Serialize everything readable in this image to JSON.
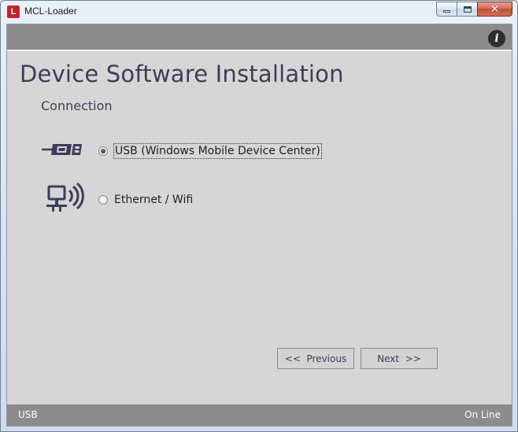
{
  "window": {
    "title": "MCL-Loader",
    "app_icon_letter": "L"
  },
  "header": {
    "title": "Device Software Installation",
    "subtitle": "Connection"
  },
  "options": [
    {
      "label": "USB  (Windows Mobile Device Center)",
      "icon": "usb-icon",
      "selected": true
    },
    {
      "label": "Ethernet / Wifi",
      "icon": "network-wifi-icon",
      "selected": false
    }
  ],
  "buttons": {
    "previous": "<<  Previous",
    "next": "Next  >>"
  },
  "status": {
    "connection_type": "USB",
    "state": "On Line"
  },
  "colors": {
    "bar_gray": "#8c8c8c",
    "panel": "#d6d6d6",
    "heading": "#3c3d59",
    "app_icon_red": "#c8202a"
  }
}
